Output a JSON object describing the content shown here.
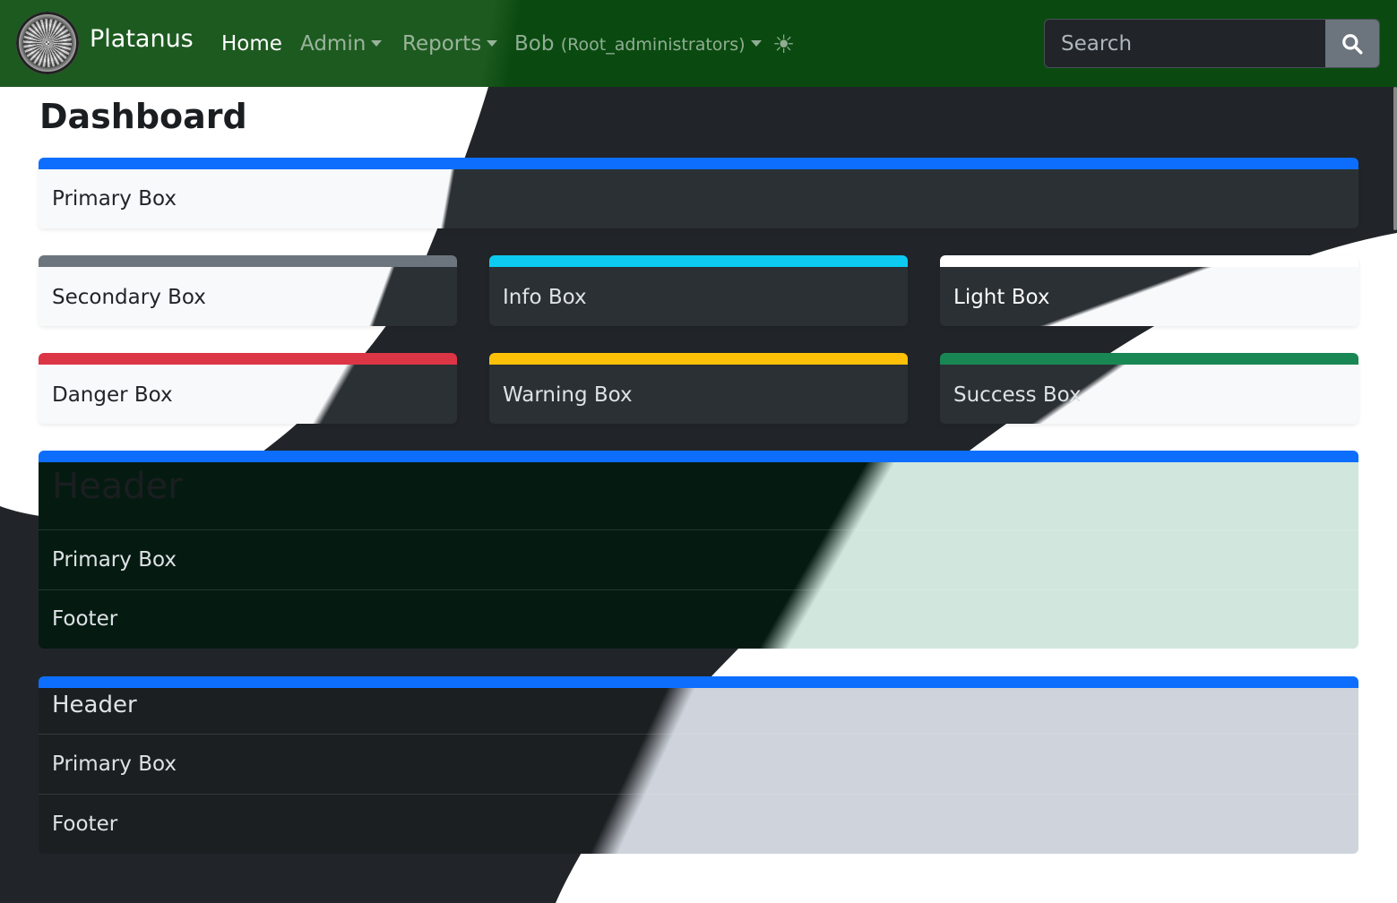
{
  "navbar": {
    "brand": "Platanus",
    "links": {
      "home": "Home",
      "admin": "Admin",
      "reports": "Reports",
      "user_name": "Bob",
      "user_group": "(Root_administrators)"
    },
    "theme_icon": "sun-icon",
    "search": {
      "placeholder": "Search",
      "button_icon": "search-icon"
    }
  },
  "page": {
    "title": "Dashboard"
  },
  "boxes": {
    "primary": "Primary Box",
    "secondary": "Secondary Box",
    "info": "Info Box",
    "light": "Light Box",
    "danger": "Danger Box",
    "warning": "Warning Box",
    "success": "Success Box"
  },
  "card1": {
    "header": "Header",
    "body": "Primary Box",
    "footer": "Footer"
  },
  "card2": {
    "header": "Header",
    "body": "Primary Box",
    "footer": "Footer"
  },
  "colors": {
    "primary": "#0d6efd",
    "secondary": "#6c757d",
    "info": "#0dcaf0",
    "light": "#f8f9fa",
    "danger": "#dc3545",
    "warning": "#ffc107",
    "success": "#198754",
    "navbar": "#0a4a10",
    "dark_bg": "#212529"
  }
}
